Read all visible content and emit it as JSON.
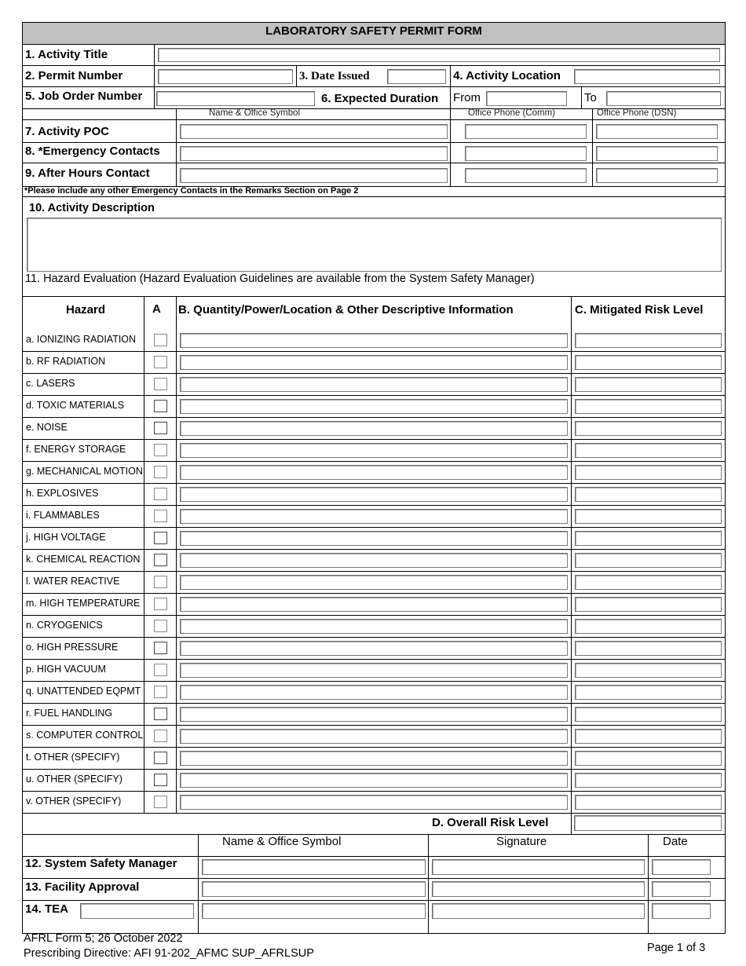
{
  "form": {
    "title": "LABORATORY SAFETY PERMIT FORM",
    "footer_form_id": "AFRL Form 5; 26 October 2022",
    "footer_directive": "Prescribing Directive:  AFI 91-202_AFMC SUP_AFRLSUP",
    "page_indicator": "Page 1 of 3"
  },
  "header_fields": {
    "activity_title": {
      "label": "1.  Activity Title",
      "value": ""
    },
    "permit_number": {
      "label": "2.  Permit Number",
      "value": ""
    },
    "date_issued": {
      "label": "3. Date Issued",
      "value": ""
    },
    "activity_location": {
      "label": "4.  Activity Location",
      "value": ""
    },
    "job_order_number": {
      "label": "5.  Job Order Number",
      "value": ""
    },
    "expected_duration": {
      "label": "6.  Expected Duration",
      "from_label": "From",
      "from_value": "",
      "to_label": "To",
      "to_value": ""
    }
  },
  "contacts": {
    "col_headers": [
      "Name & Office Symbol",
      "Office Phone (Comm)",
      "Office Phone (DSN)"
    ],
    "rows": [
      {
        "label": "7.  Activity POC",
        "name": "",
        "comm": "",
        "dsn": ""
      },
      {
        "label": "8.  *Emergency Contacts",
        "name": "",
        "comm": "",
        "dsn": ""
      },
      {
        "label": "9.  After  Hours Contact",
        "name": "",
        "comm": "",
        "dsn": ""
      }
    ],
    "note": "*Please include any other Emergency Contacts in the Remarks Section on Page 2"
  },
  "activity_description": {
    "label": "10.  Activity Description",
    "value": ""
  },
  "hazard_evaluation": {
    "title": "11.  Hazard Evaluation (Hazard Evaluation Guidelines are available from the System Safety Manager)",
    "col_hazard": "Hazard",
    "col_a": "A",
    "col_b": "B.  Quantity/Power/Location & Other Descriptive Information",
    "col_c": "C.  Mitigated Risk Level",
    "rows": [
      {
        "label": "a.  IONIZING RADIATION",
        "checked": false,
        "info": "",
        "risk": ""
      },
      {
        "label": "b.  RF RADIATION",
        "checked": false,
        "info": "",
        "risk": ""
      },
      {
        "label": "c.  LASERS",
        "checked": false,
        "info": "",
        "risk": ""
      },
      {
        "label": "d.  TOXIC MATERIALS",
        "checked": false,
        "info": "",
        "risk": ""
      },
      {
        "label": "e.  NOISE",
        "checked": false,
        "info": "",
        "risk": ""
      },
      {
        "label": "f. ENERGY STORAGE",
        "checked": false,
        "info": "",
        "risk": ""
      },
      {
        "label": "g. MECHANICAL MOTION",
        "checked": false,
        "info": "",
        "risk": ""
      },
      {
        "label": "h.  EXPLOSIVES",
        "checked": false,
        "info": "",
        "risk": ""
      },
      {
        "label": "i.  FLAMMABLES",
        "checked": false,
        "info": "",
        "risk": ""
      },
      {
        "label": "j.  HIGH VOLTAGE",
        "checked": false,
        "info": "",
        "risk": ""
      },
      {
        "label": "k.  CHEMICAL REACTION",
        "checked": false,
        "info": "",
        "risk": ""
      },
      {
        "label": "l.  WATER REACTIVE",
        "checked": false,
        "info": "",
        "risk": ""
      },
      {
        "label": "m.  HIGH TEMPERATURE",
        "checked": false,
        "info": "",
        "risk": ""
      },
      {
        "label": "n.  CRYOGENICS",
        "checked": false,
        "info": "",
        "risk": ""
      },
      {
        "label": "o.  HIGH PRESSURE",
        "checked": false,
        "info": "",
        "risk": ""
      },
      {
        "label": "p.  HIGH VACUUM",
        "checked": false,
        "info": "",
        "risk": ""
      },
      {
        "label": "q.  UNATTENDED EQPMT",
        "checked": false,
        "info": "",
        "risk": ""
      },
      {
        "label": "r.  FUEL HANDLING",
        "checked": false,
        "info": "",
        "risk": ""
      },
      {
        "label": "s. COMPUTER CONTROL",
        "checked": false,
        "info": "",
        "risk": ""
      },
      {
        "label": "t. OTHER (SPECIFY)",
        "checked": false,
        "info": "",
        "risk": ""
      },
      {
        "label": "u.  OTHER (SPECIFY)",
        "checked": false,
        "info": "",
        "risk": ""
      },
      {
        "label": "v. OTHER (SPECIFY)",
        "checked": false,
        "info": "",
        "risk": ""
      }
    ],
    "overall_risk_label": "D.  Overall Risk  Level",
    "overall_risk_value": ""
  },
  "approvals": {
    "col_headers": [
      "Name & Office Symbol",
      "Signature",
      "Date"
    ],
    "rows": [
      {
        "label": "12.  System Safety Manager",
        "name": "",
        "signature": "",
        "date": ""
      },
      {
        "label": "13.  Facility Approval",
        "name": "",
        "signature": "",
        "date": ""
      },
      {
        "label": "14.  TEA",
        "tea_value": "",
        "name": "",
        "signature": "",
        "date": ""
      }
    ]
  }
}
